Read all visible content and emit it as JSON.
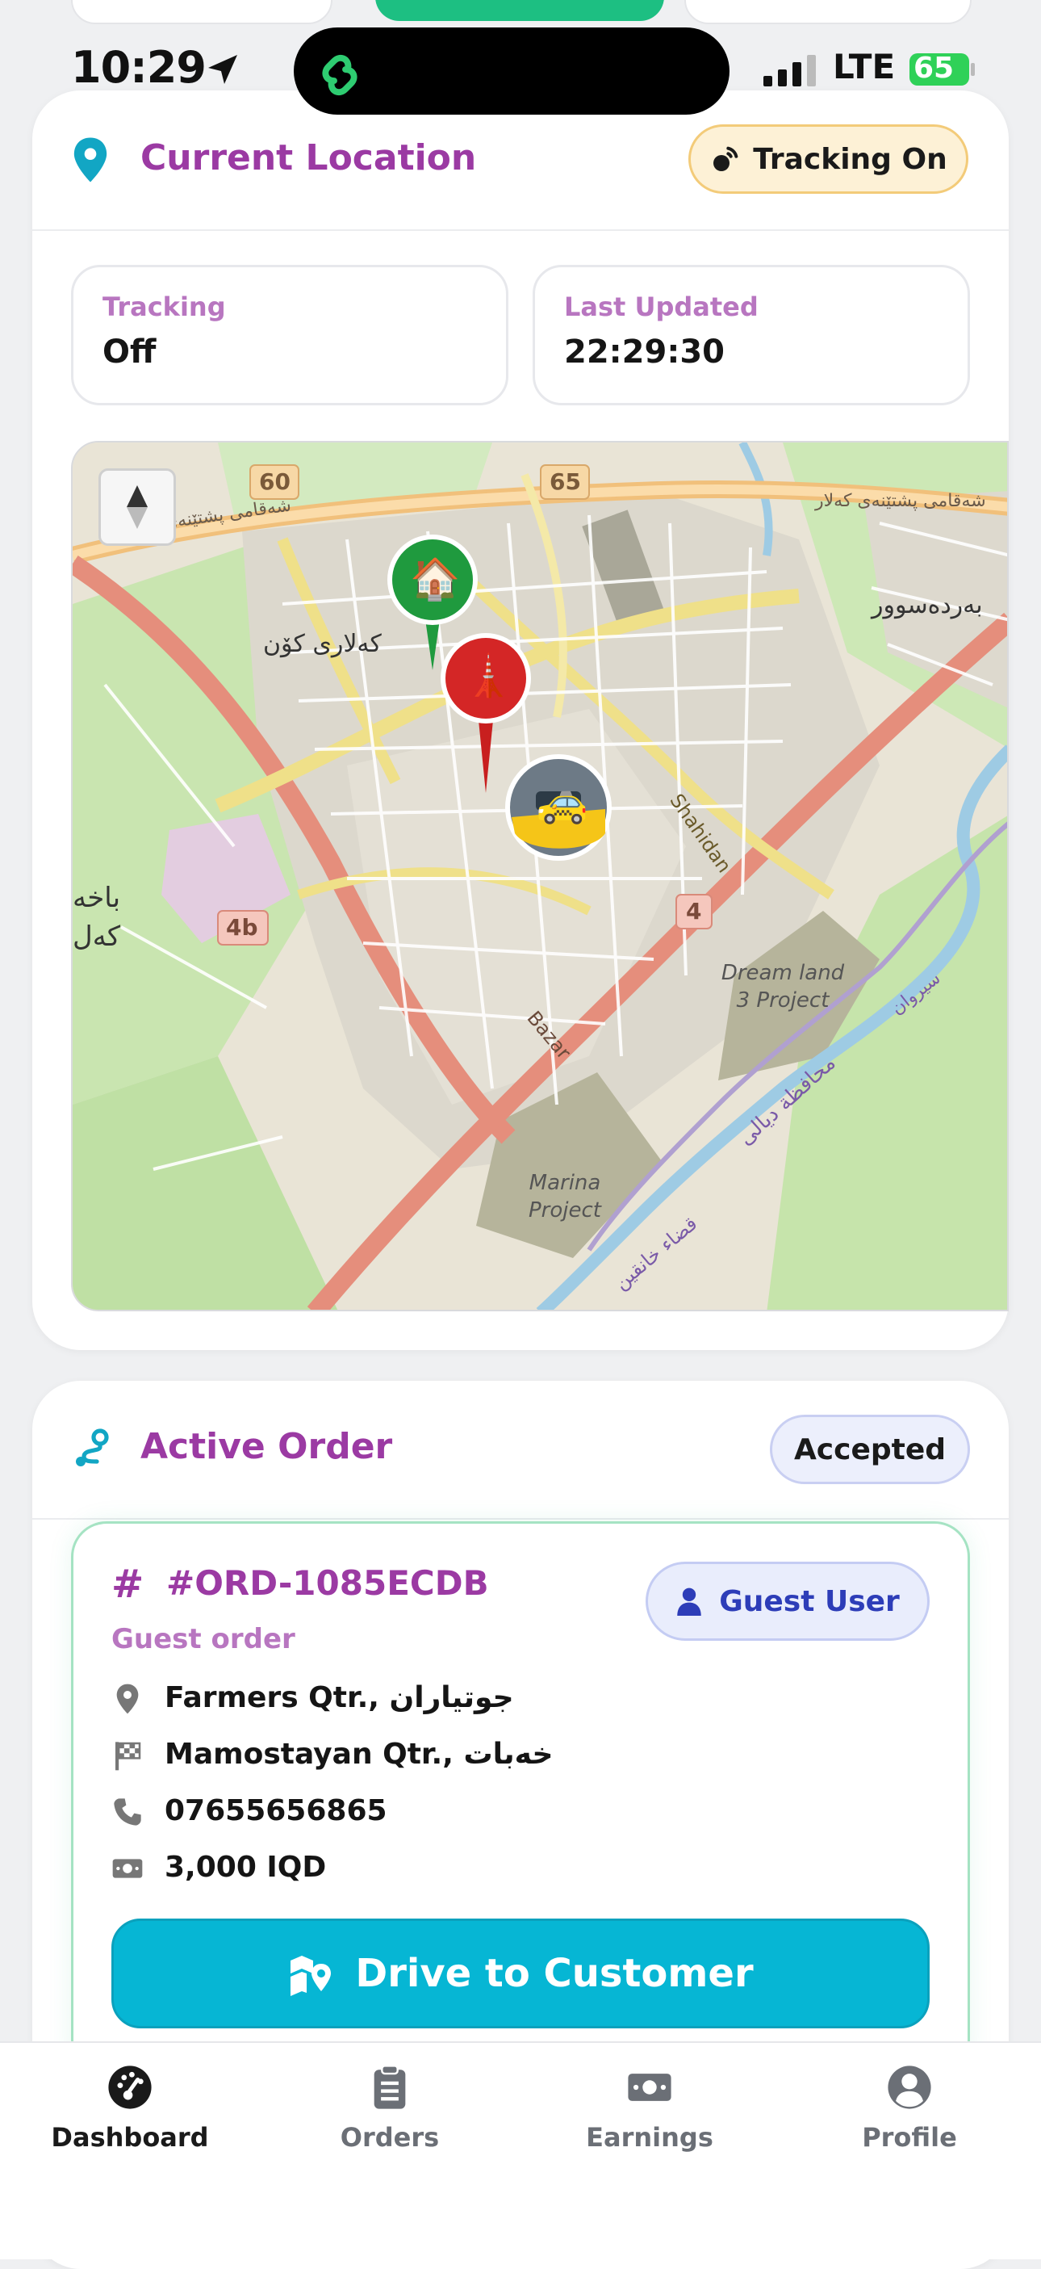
{
  "status_bar": {
    "time": "10:29",
    "network": "LTE",
    "battery": "65"
  },
  "location_card": {
    "title": "Current Location",
    "tracking_badge": "Tracking On",
    "tracking_label": "Tracking",
    "tracking_value": "Off",
    "updated_label": "Last Updated",
    "updated_value": "22:29:30"
  },
  "map": {
    "road_labels": {
      "r60": "60",
      "r65": "65",
      "r4b": "4b",
      "r4": "4",
      "top_street": "شەقامی پشتێنەی کەلار",
      "top_street_right": "شەقامی پشتێنەی کەلار",
      "kalari_kon": "کەلاری کۆن",
      "bardasur": "بەردەسوور",
      "shahidan": "Shahidan",
      "bazar": "Bazar",
      "dream_land": "Dream land 3 Project",
      "marina": "Marina Project",
      "bakhakal": "باخەکەل",
      "diyala": "محافظة ديالى",
      "khanaqin": "قضاء خانقين",
      "sirwan": "سیروان"
    },
    "markers": [
      {
        "name": "home-marker",
        "glyph": "🏠",
        "color": "#1f9a3e"
      },
      {
        "name": "tower-marker",
        "glyph": "🗼",
        "color": "#d42626"
      },
      {
        "name": "taxi-marker",
        "glyph": "🚕",
        "color": "#f5c518"
      }
    ]
  },
  "order_card": {
    "title": "Active Order",
    "status": "Accepted",
    "order_id": "#ORD-1085ECDB",
    "order_type": "Guest order",
    "guest_badge": "Guest User",
    "pickup": "Farmers Qtr., جوتیاران",
    "destination": "Mamostayan Qtr., خەبات",
    "phone": "07655656865",
    "price": "3,000 IQD",
    "action": "Drive to Customer"
  },
  "nav": {
    "items": [
      {
        "label": "Dashboard",
        "icon": "dashboard-icon",
        "active": true
      },
      {
        "label": "Orders",
        "icon": "clipboard-icon",
        "active": false
      },
      {
        "label": "Earnings",
        "icon": "money-icon",
        "active": false
      },
      {
        "label": "Profile",
        "icon": "profile-icon",
        "active": false
      }
    ]
  },
  "colors": {
    "accent_purple": "#9b3aa3",
    "accent_cyan": "#06b6d4",
    "success_green": "#1dbf82"
  }
}
